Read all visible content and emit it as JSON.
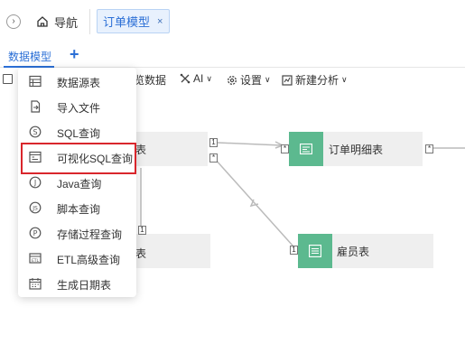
{
  "topbar": {
    "home_label": "导航",
    "active_tab": "订单模型",
    "close_glyph": "×"
  },
  "subtabs": {
    "active_label": "数据模型",
    "add_glyph": "+"
  },
  "toolbar": {
    "preview_fragment": "览数据",
    "ai_label": "AI",
    "settings_label": "设置",
    "new_analysis_label": "新建分析"
  },
  "canvas": {
    "nodes": {
      "left_top_fragment": "表",
      "left_bottom_fragment": "表",
      "order_detail": "订单明细表",
      "employee": "雇员表"
    },
    "ports": {
      "one": "1",
      "star": "*"
    }
  },
  "menu": {
    "items": [
      {
        "label": "数据源表",
        "icon": "table-icon"
      },
      {
        "label": "导入文件",
        "icon": "import-file-icon"
      },
      {
        "label": "SQL查询",
        "icon": "sql-icon"
      },
      {
        "label": "可视化SQL查询",
        "icon": "visual-sql-icon"
      },
      {
        "label": "Java查询",
        "icon": "java-icon"
      },
      {
        "label": "脚本查询",
        "icon": "script-icon"
      },
      {
        "label": "存储过程查询",
        "icon": "procedure-icon"
      },
      {
        "label": "ETL高级查询",
        "icon": "etl-icon"
      },
      {
        "label": "生成日期表",
        "icon": "calendar-icon"
      }
    ],
    "highlighted_index": 3,
    "highlight_color": "#d9262c"
  },
  "colors": {
    "accent": "#2b6fd6",
    "node_green": "#5cb98f"
  }
}
